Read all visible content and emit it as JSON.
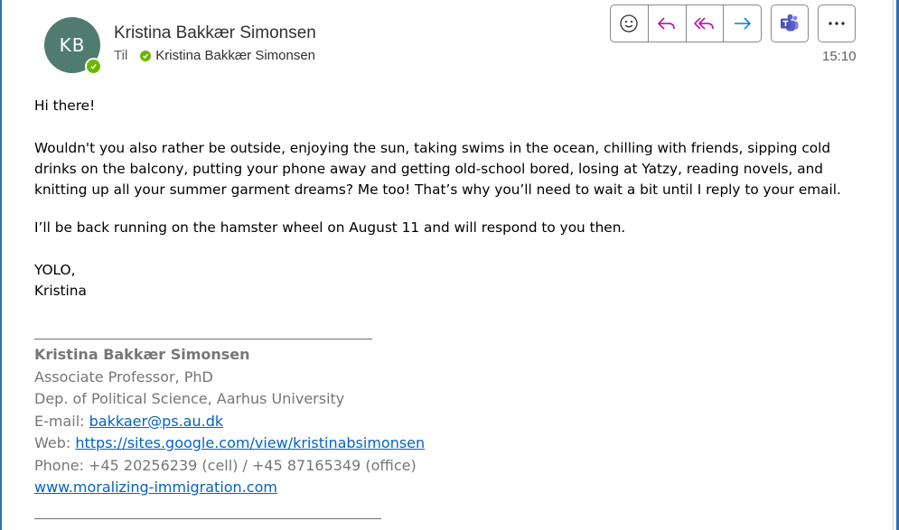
{
  "header": {
    "avatar_initials": "KB",
    "sender_name": "Kristina Bakkær Simonsen",
    "to_label": "Til",
    "recipient_name": "Kristina Bakkær Simonsen",
    "time": "15:10"
  },
  "toolbar": {
    "icons": [
      "emoji-icon",
      "reply-icon",
      "reply-all-icon",
      "forward-icon",
      "teams-icon",
      "more-icon"
    ]
  },
  "message": {
    "greeting": "Hi there!",
    "paragraph1": "Wouldn't you also rather be outside, enjoying the sun, taking swims in the ocean, chilling with friends, sipping cold drinks on the balcony, putting your phone away and getting old-school bored, losing at Yatzy, reading novels, and knitting up all your summer garment dreams? Me too! That’s why you’ll need to wait a bit until I reply to your email.",
    "paragraph2": "I’ll be back running on the hamster wheel on August 11 and will respond to you then.",
    "signoff": "YOLO,",
    "signoff_name": "Kristina"
  },
  "signature": {
    "name": "Kristina Bakkær Simonsen",
    "title": "Associate Professor, PhD",
    "department": "Dep. of Political Science, Aarhus University",
    "email_label": "E-mail: ",
    "email": "bakkaer@ps.au.dk",
    "web_label": "Web: ",
    "web": "https://sites.google.com/view/kristinabsimonsen",
    "phone": "Phone: +45 20256239 (cell) / +45 87165349 (office)",
    "website": "www.moralizing-immigration.com"
  },
  "colors": {
    "avatar": "#4f7c6f",
    "presence": "#6bb700",
    "reply_icons": "#b4009e",
    "forward_icon": "#0078d4",
    "teams": "#5b5fc7",
    "link": "#0563c1"
  }
}
